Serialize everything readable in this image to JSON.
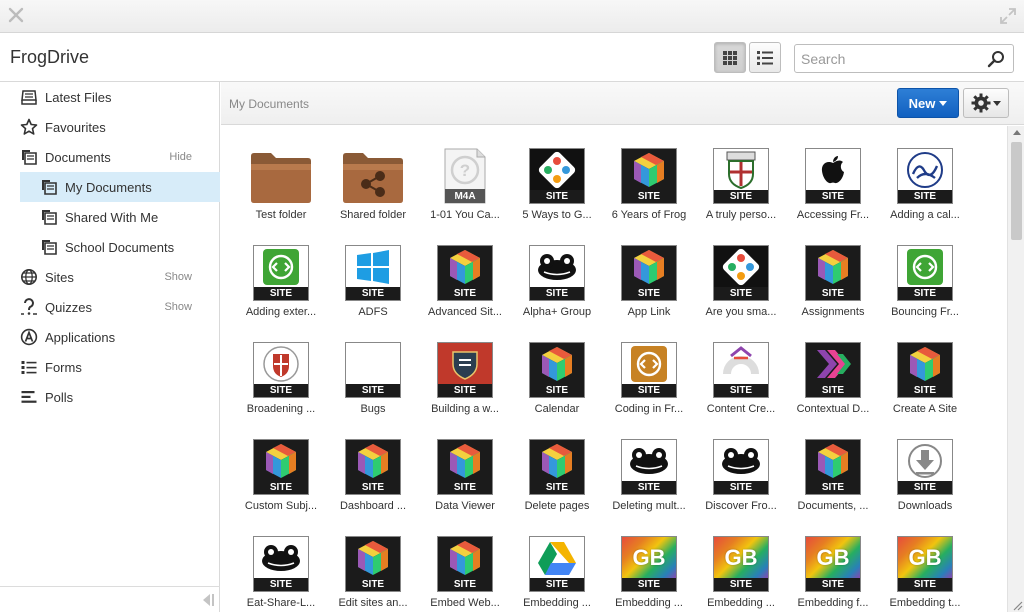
{
  "app": {
    "title": "FrogDrive"
  },
  "colors": {
    "accent": "#1565c0",
    "selected": "#d7ecf9"
  },
  "search": {
    "placeholder": "Search",
    "value": ""
  },
  "sidebar": {
    "items": [
      {
        "label": "Latest Files",
        "icon": "inbox-icon",
        "toggle": ""
      },
      {
        "label": "Favourites",
        "icon": "star-icon",
        "toggle": ""
      },
      {
        "label": "Documents",
        "icon": "documents-icon",
        "toggle": "Hide"
      },
      {
        "label": "My Documents",
        "icon": "document-icon",
        "toggle": "",
        "selected": true
      },
      {
        "label": "Shared With Me",
        "icon": "document-icon",
        "toggle": ""
      },
      {
        "label": "School Documents",
        "icon": "document-icon",
        "toggle": ""
      },
      {
        "label": "Sites",
        "icon": "globe-icon",
        "toggle": "Show"
      },
      {
        "label": "Quizzes",
        "icon": "quiz-icon",
        "toggle": "Show"
      },
      {
        "label": "Applications",
        "icon": "applications-icon",
        "toggle": ""
      },
      {
        "label": "Forms",
        "icon": "forms-icon",
        "toggle": ""
      },
      {
        "label": "Polls",
        "icon": "polls-icon",
        "toggle": ""
      }
    ]
  },
  "toolbar": {
    "breadcrumb": "My Documents",
    "new_label": "New"
  },
  "files": [
    {
      "name": "Test folder",
      "kind": "folder"
    },
    {
      "name": "Shared folder",
      "kind": "shared-folder"
    },
    {
      "name": "1-01 You Ca...",
      "kind": "m4a",
      "badge": "M4A"
    },
    {
      "name": "5 Ways to G...",
      "kind": "site",
      "art": "dots",
      "badge": "SITE"
    },
    {
      "name": "6 Years of Frog",
      "kind": "site",
      "art": "cube",
      "badge": "SITE"
    },
    {
      "name": "A truly perso...",
      "kind": "site",
      "art": "crest",
      "badge": "SITE"
    },
    {
      "name": "Accessing Fr...",
      "kind": "site",
      "art": "apple",
      "badge": "SITE"
    },
    {
      "name": "Adding a cal...",
      "kind": "site",
      "art": "script",
      "badge": "SITE"
    },
    {
      "name": "Adding exter...",
      "kind": "site",
      "art": "green-code",
      "badge": "SITE"
    },
    {
      "name": "ADFS",
      "kind": "site",
      "art": "windows",
      "badge": "SITE"
    },
    {
      "name": "Advanced Sit...",
      "kind": "site",
      "art": "cube",
      "badge": "SITE"
    },
    {
      "name": "Alpha+ Group",
      "kind": "site",
      "art": "frog",
      "badge": "SITE"
    },
    {
      "name": "App Link",
      "kind": "site",
      "art": "cube",
      "badge": "SITE"
    },
    {
      "name": "Are you sma...",
      "kind": "site",
      "art": "dots",
      "badge": "SITE"
    },
    {
      "name": "Assignments",
      "kind": "site",
      "art": "cube",
      "badge": "SITE"
    },
    {
      "name": "Bouncing Fr...",
      "kind": "site",
      "art": "green-code",
      "badge": "SITE"
    },
    {
      "name": "Broadening ...",
      "kind": "site",
      "art": "badge",
      "badge": "SITE"
    },
    {
      "name": "Bugs",
      "kind": "site",
      "art": "blank",
      "badge": "SITE"
    },
    {
      "name": "Building a w...",
      "kind": "site",
      "art": "red-shield",
      "badge": "SITE"
    },
    {
      "name": "Calendar",
      "kind": "site",
      "art": "cube",
      "badge": "SITE"
    },
    {
      "name": "Coding in Fr...",
      "kind": "site",
      "art": "orange-code",
      "badge": "SITE"
    },
    {
      "name": "Content Cre...",
      "kind": "site",
      "art": "arc",
      "badge": "SITE"
    },
    {
      "name": "Contextual D...",
      "kind": "site",
      "art": "arrows",
      "badge": "SITE"
    },
    {
      "name": "Create A Site",
      "kind": "site",
      "art": "cube",
      "badge": "SITE"
    },
    {
      "name": "Custom Subj...",
      "kind": "site",
      "art": "cube",
      "badge": "SITE"
    },
    {
      "name": "Dashboard ...",
      "kind": "site",
      "art": "cube",
      "badge": "SITE"
    },
    {
      "name": "Data Viewer",
      "kind": "site",
      "art": "cube",
      "badge": "SITE"
    },
    {
      "name": "Delete pages",
      "kind": "site",
      "art": "cube",
      "badge": "SITE"
    },
    {
      "name": "Deleting mult...",
      "kind": "site",
      "art": "frog",
      "badge": "SITE"
    },
    {
      "name": "Discover Fro...",
      "kind": "site",
      "art": "frog",
      "badge": "SITE"
    },
    {
      "name": "Documents, ...",
      "kind": "site",
      "art": "cube",
      "badge": "SITE"
    },
    {
      "name": "Downloads",
      "kind": "site",
      "art": "download",
      "badge": "SITE"
    },
    {
      "name": "Eat-Share-L...",
      "kind": "site",
      "art": "frog",
      "badge": "SITE"
    },
    {
      "name": "Edit sites an...",
      "kind": "site",
      "art": "cube",
      "badge": "SITE"
    },
    {
      "name": "Embed Web...",
      "kind": "site",
      "art": "cube",
      "badge": "SITE"
    },
    {
      "name": "Embedding ...",
      "kind": "site",
      "art": "drive",
      "badge": "SITE"
    },
    {
      "name": "Embedding ...",
      "kind": "site",
      "art": "gb",
      "badge": "SITE",
      "art_text": "GB"
    },
    {
      "name": "Embedding ...",
      "kind": "site",
      "art": "gb",
      "badge": "SITE",
      "art_text": "GB"
    },
    {
      "name": "Embedding f...",
      "kind": "site",
      "art": "gb",
      "badge": "SITE",
      "art_text": "GB"
    },
    {
      "name": "Embedding t...",
      "kind": "site",
      "art": "gb",
      "badge": "SITE",
      "art_text": "GB"
    }
  ]
}
